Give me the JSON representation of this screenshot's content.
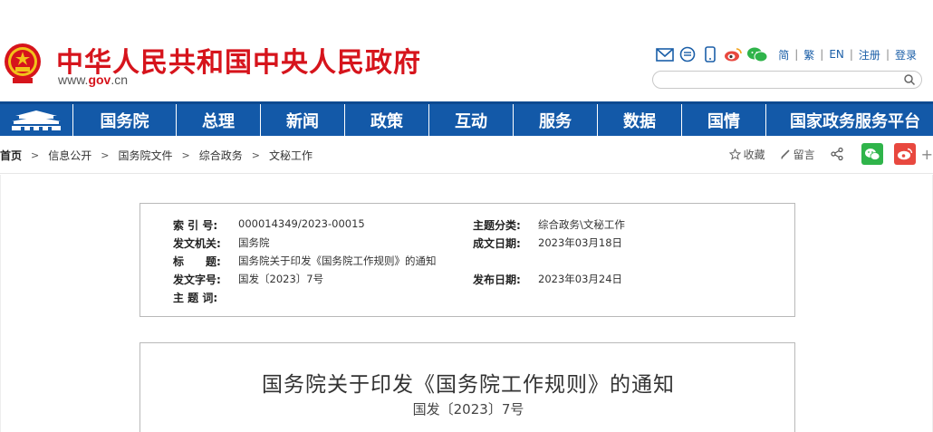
{
  "header": {
    "site_title": "中华人民共和国中央人民政府",
    "url_prefix": "www.",
    "url_gov": "gov",
    "url_suffix": ".cn",
    "links": [
      "简",
      "繁",
      "EN",
      "注册",
      "登录"
    ],
    "search_placeholder": "",
    "brand_color": "#d6141c",
    "link_color": "#1b5fa8"
  },
  "nav": {
    "background": "#1359a8",
    "items": [
      "国务院",
      "总理",
      "新闻",
      "政策",
      "互动",
      "服务",
      "数据",
      "国情",
      "国家政务服务平台"
    ]
  },
  "breadcrumb": {
    "items": [
      "首页",
      "信息公开",
      "国务院文件",
      "综合政务",
      "文秘工作"
    ]
  },
  "actions": {
    "favorite": "收藏",
    "comment": "留言",
    "plus": "+"
  },
  "meta": {
    "index_label": "索 引 号:",
    "index_value": "000014349/2023-00015",
    "topic_label": "主题分类:",
    "topic_value": "综合政务\\文秘工作",
    "issuer_label": "发文机关:",
    "issuer_value": "国务院",
    "written_label": "成文日期:",
    "written_value": "2023年03月18日",
    "title_label": "标　　题:",
    "title_value": "国务院关于印发《国务院工作规则》的通知",
    "docno_label": "发文字号:",
    "docno_value": "国发〔2023〕7号",
    "publish_label": "发布日期:",
    "publish_value": "2023年03月24日",
    "keywords_label": "主 题 词:",
    "keywords_value": ""
  },
  "document": {
    "title": "国务院关于印发《国务院工作规则》的通知",
    "number": "国发〔2023〕7号"
  }
}
